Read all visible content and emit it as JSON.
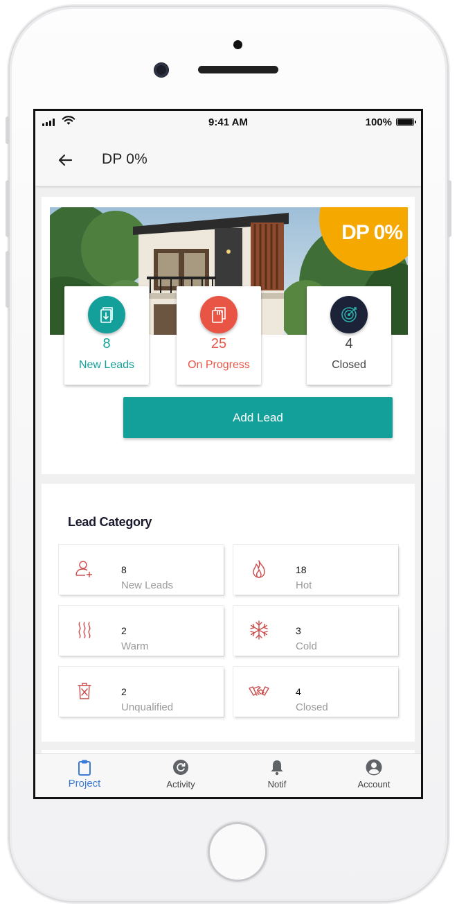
{
  "status_bar": {
    "time": "9:41 AM",
    "battery": "100%"
  },
  "header": {
    "title": "DP 0%"
  },
  "hero": {
    "badge": "DP 0%"
  },
  "stats": [
    {
      "value": "8",
      "label": "New Leads",
      "color": "#13a09b",
      "icon": "download-document-icon"
    },
    {
      "value": "25",
      "label": "On Progress",
      "color": "#e85545",
      "icon": "document-progress-icon"
    },
    {
      "value": "4",
      "label": "Closed",
      "color": "#444444",
      "icon": "target-icon"
    }
  ],
  "add_lead_label": "Add Lead",
  "lead_category": {
    "title": "Lead Category",
    "items": [
      {
        "value": "8",
        "label": "New Leads",
        "icon": "add-user-icon"
      },
      {
        "value": "18",
        "label": "Hot",
        "icon": "fire-icon"
      },
      {
        "value": "2",
        "label": "Warm",
        "icon": "heat-waves-icon"
      },
      {
        "value": "3",
        "label": "Cold",
        "icon": "snowflake-icon"
      },
      {
        "value": "2",
        "label": "Unqualified",
        "icon": "trash-icon"
      },
      {
        "value": "4",
        "label": "Closed",
        "icon": "handshake-icon"
      }
    ]
  },
  "nav": [
    {
      "label": "Project",
      "active": true,
      "icon": "clipboard-icon"
    },
    {
      "label": "Activity",
      "active": false,
      "icon": "refresh-icon"
    },
    {
      "label": "Notif",
      "active": false,
      "icon": "bell-icon"
    },
    {
      "label": "Account",
      "active": false,
      "icon": "account-icon"
    }
  ],
  "colors": {
    "accent": "#13a09b",
    "danger": "#e85545",
    "badge": "#f5a800",
    "nav_active": "#3a7bd5"
  }
}
